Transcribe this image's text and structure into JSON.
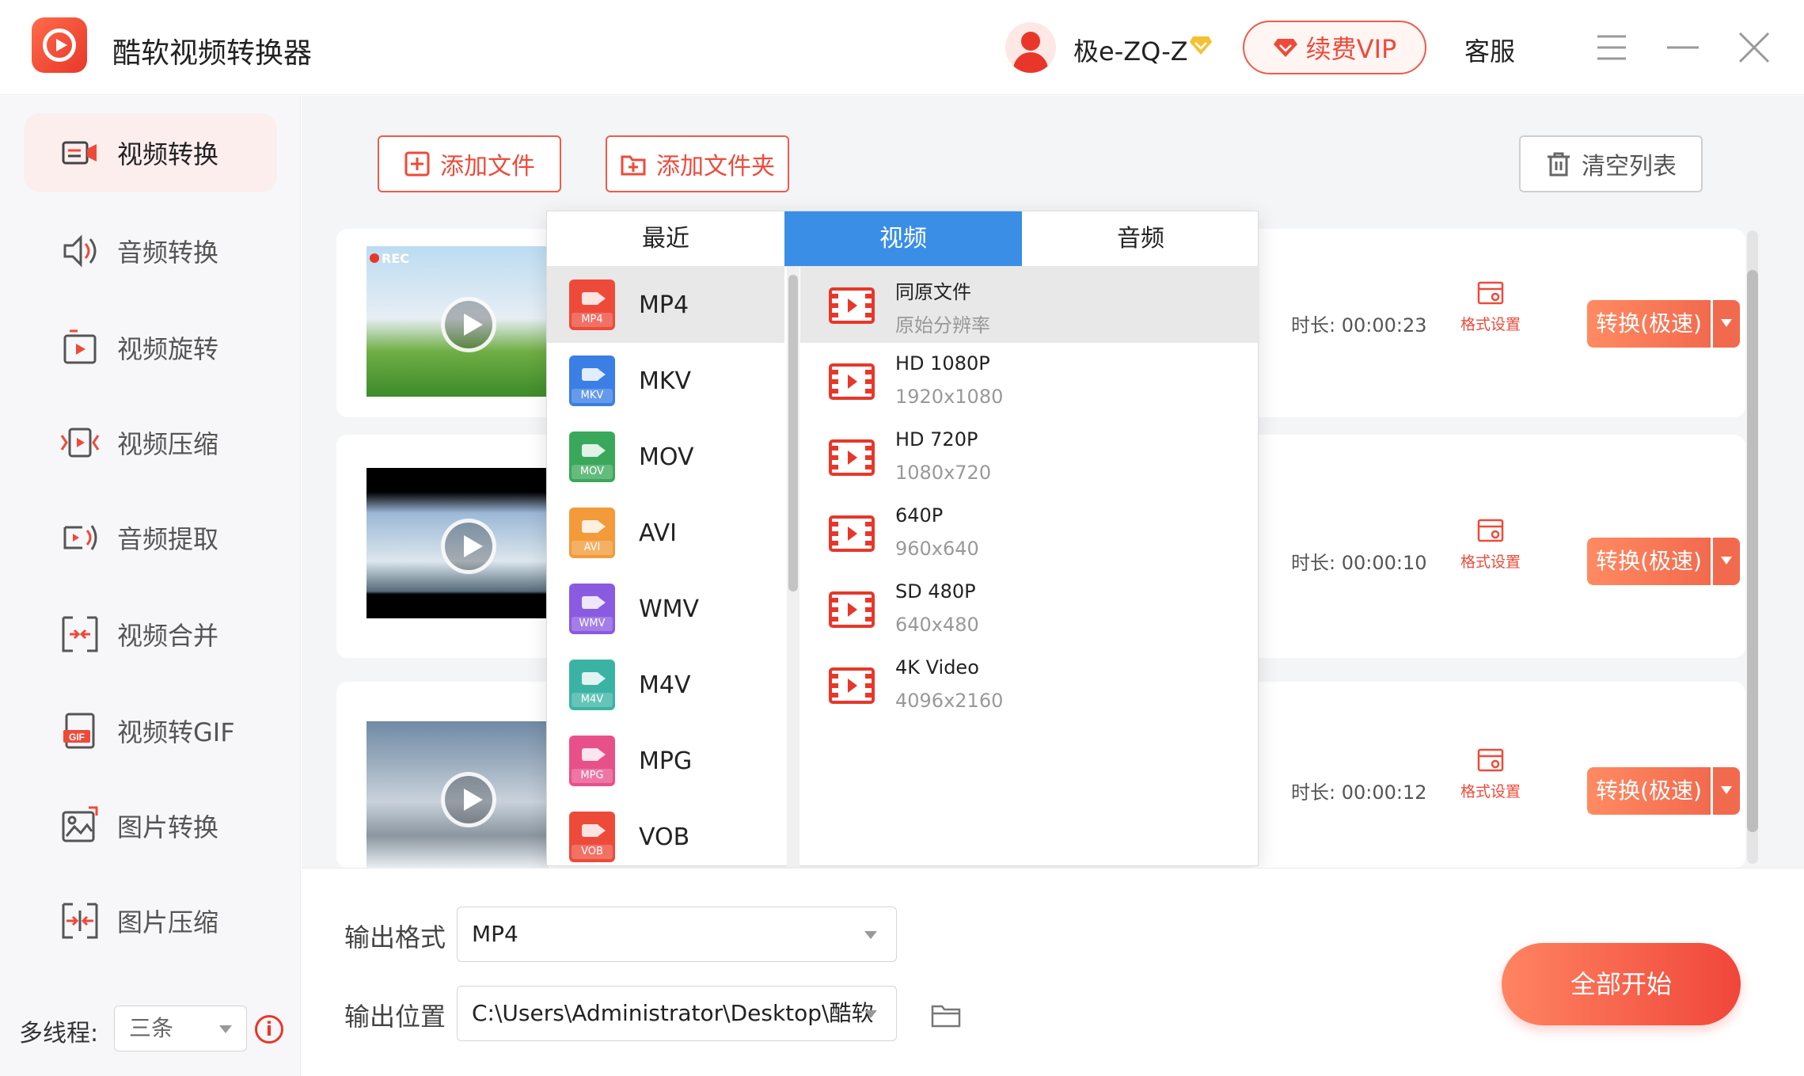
{
  "app": {
    "title": "酷软视频转换器",
    "username": "极e-ZQ-Z",
    "vip_label": "续费VIP",
    "service_label": "客服"
  },
  "colors": {
    "accent": "#ee4a3a",
    "selected_tab": "#3a8ee6",
    "active_sidebar_bg": "#fdeeee"
  },
  "sidebar": {
    "items": [
      {
        "label": "视频转换",
        "icon": "video-convert-icon",
        "active": true
      },
      {
        "label": "音频转换",
        "icon": "audio-convert-icon"
      },
      {
        "label": "视频旋转",
        "icon": "video-rotate-icon"
      },
      {
        "label": "视频压缩",
        "icon": "video-compress-icon"
      },
      {
        "label": "音频提取",
        "icon": "audio-extract-icon"
      },
      {
        "label": "视频合并",
        "icon": "video-merge-icon"
      },
      {
        "label": "视频转GIF",
        "icon": "gif-icon"
      },
      {
        "label": "图片转换",
        "icon": "image-convert-icon"
      },
      {
        "label": "图片压缩",
        "icon": "image-compress-icon"
      }
    ],
    "threads_label": "多线程:",
    "threads_value": "三条"
  },
  "toolbar": {
    "add_file": "添加文件",
    "add_folder": "添加文件夹",
    "clear_list": "清空列表"
  },
  "files": [
    {
      "duration": "时长: 00:00:23",
      "format_settings": "格式设置",
      "convert_label": "转换(极速)"
    },
    {
      "duration": "时长: 00:00:10",
      "format_settings": "格式设置",
      "convert_label": "转换(极速)"
    },
    {
      "duration": "时长: 00:00:12",
      "format_settings": "格式设置",
      "convert_label": "转换(极速)"
    }
  ],
  "thumbnail_badge": "REC",
  "dropdown": {
    "tabs": [
      "最近",
      "视频",
      "音频"
    ],
    "active_tab": "视频",
    "formats": [
      {
        "name": "MP4",
        "color": "#ee4a3a"
      },
      {
        "name": "MKV",
        "color": "#3a7ee6"
      },
      {
        "name": "MOV",
        "color": "#3aa85a"
      },
      {
        "name": "AVI",
        "color": "#f39a3a"
      },
      {
        "name": "WMV",
        "color": "#8a5ae0"
      },
      {
        "name": "M4V",
        "color": "#3ab3a5"
      },
      {
        "name": "MPG",
        "color": "#e8508a"
      },
      {
        "name": "VOB",
        "color": "#ee4a3a"
      }
    ],
    "selected_format": "MP4",
    "resolutions": [
      {
        "name": "同原文件",
        "sub": "原始分辨率"
      },
      {
        "name": "HD 1080P",
        "sub": "1920x1080"
      },
      {
        "name": "HD 720P",
        "sub": "1080x720"
      },
      {
        "name": "640P",
        "sub": "960x640"
      },
      {
        "name": "SD 480P",
        "sub": "640x480"
      },
      {
        "name": "4K Video",
        "sub": "4096x2160"
      }
    ]
  },
  "output": {
    "format_label": "输出格式",
    "format_value": "MP4",
    "location_label": "输出位置",
    "location_value": "C:\\Users\\Administrator\\Desktop\\酷软"
  },
  "start_all": "全部开始"
}
